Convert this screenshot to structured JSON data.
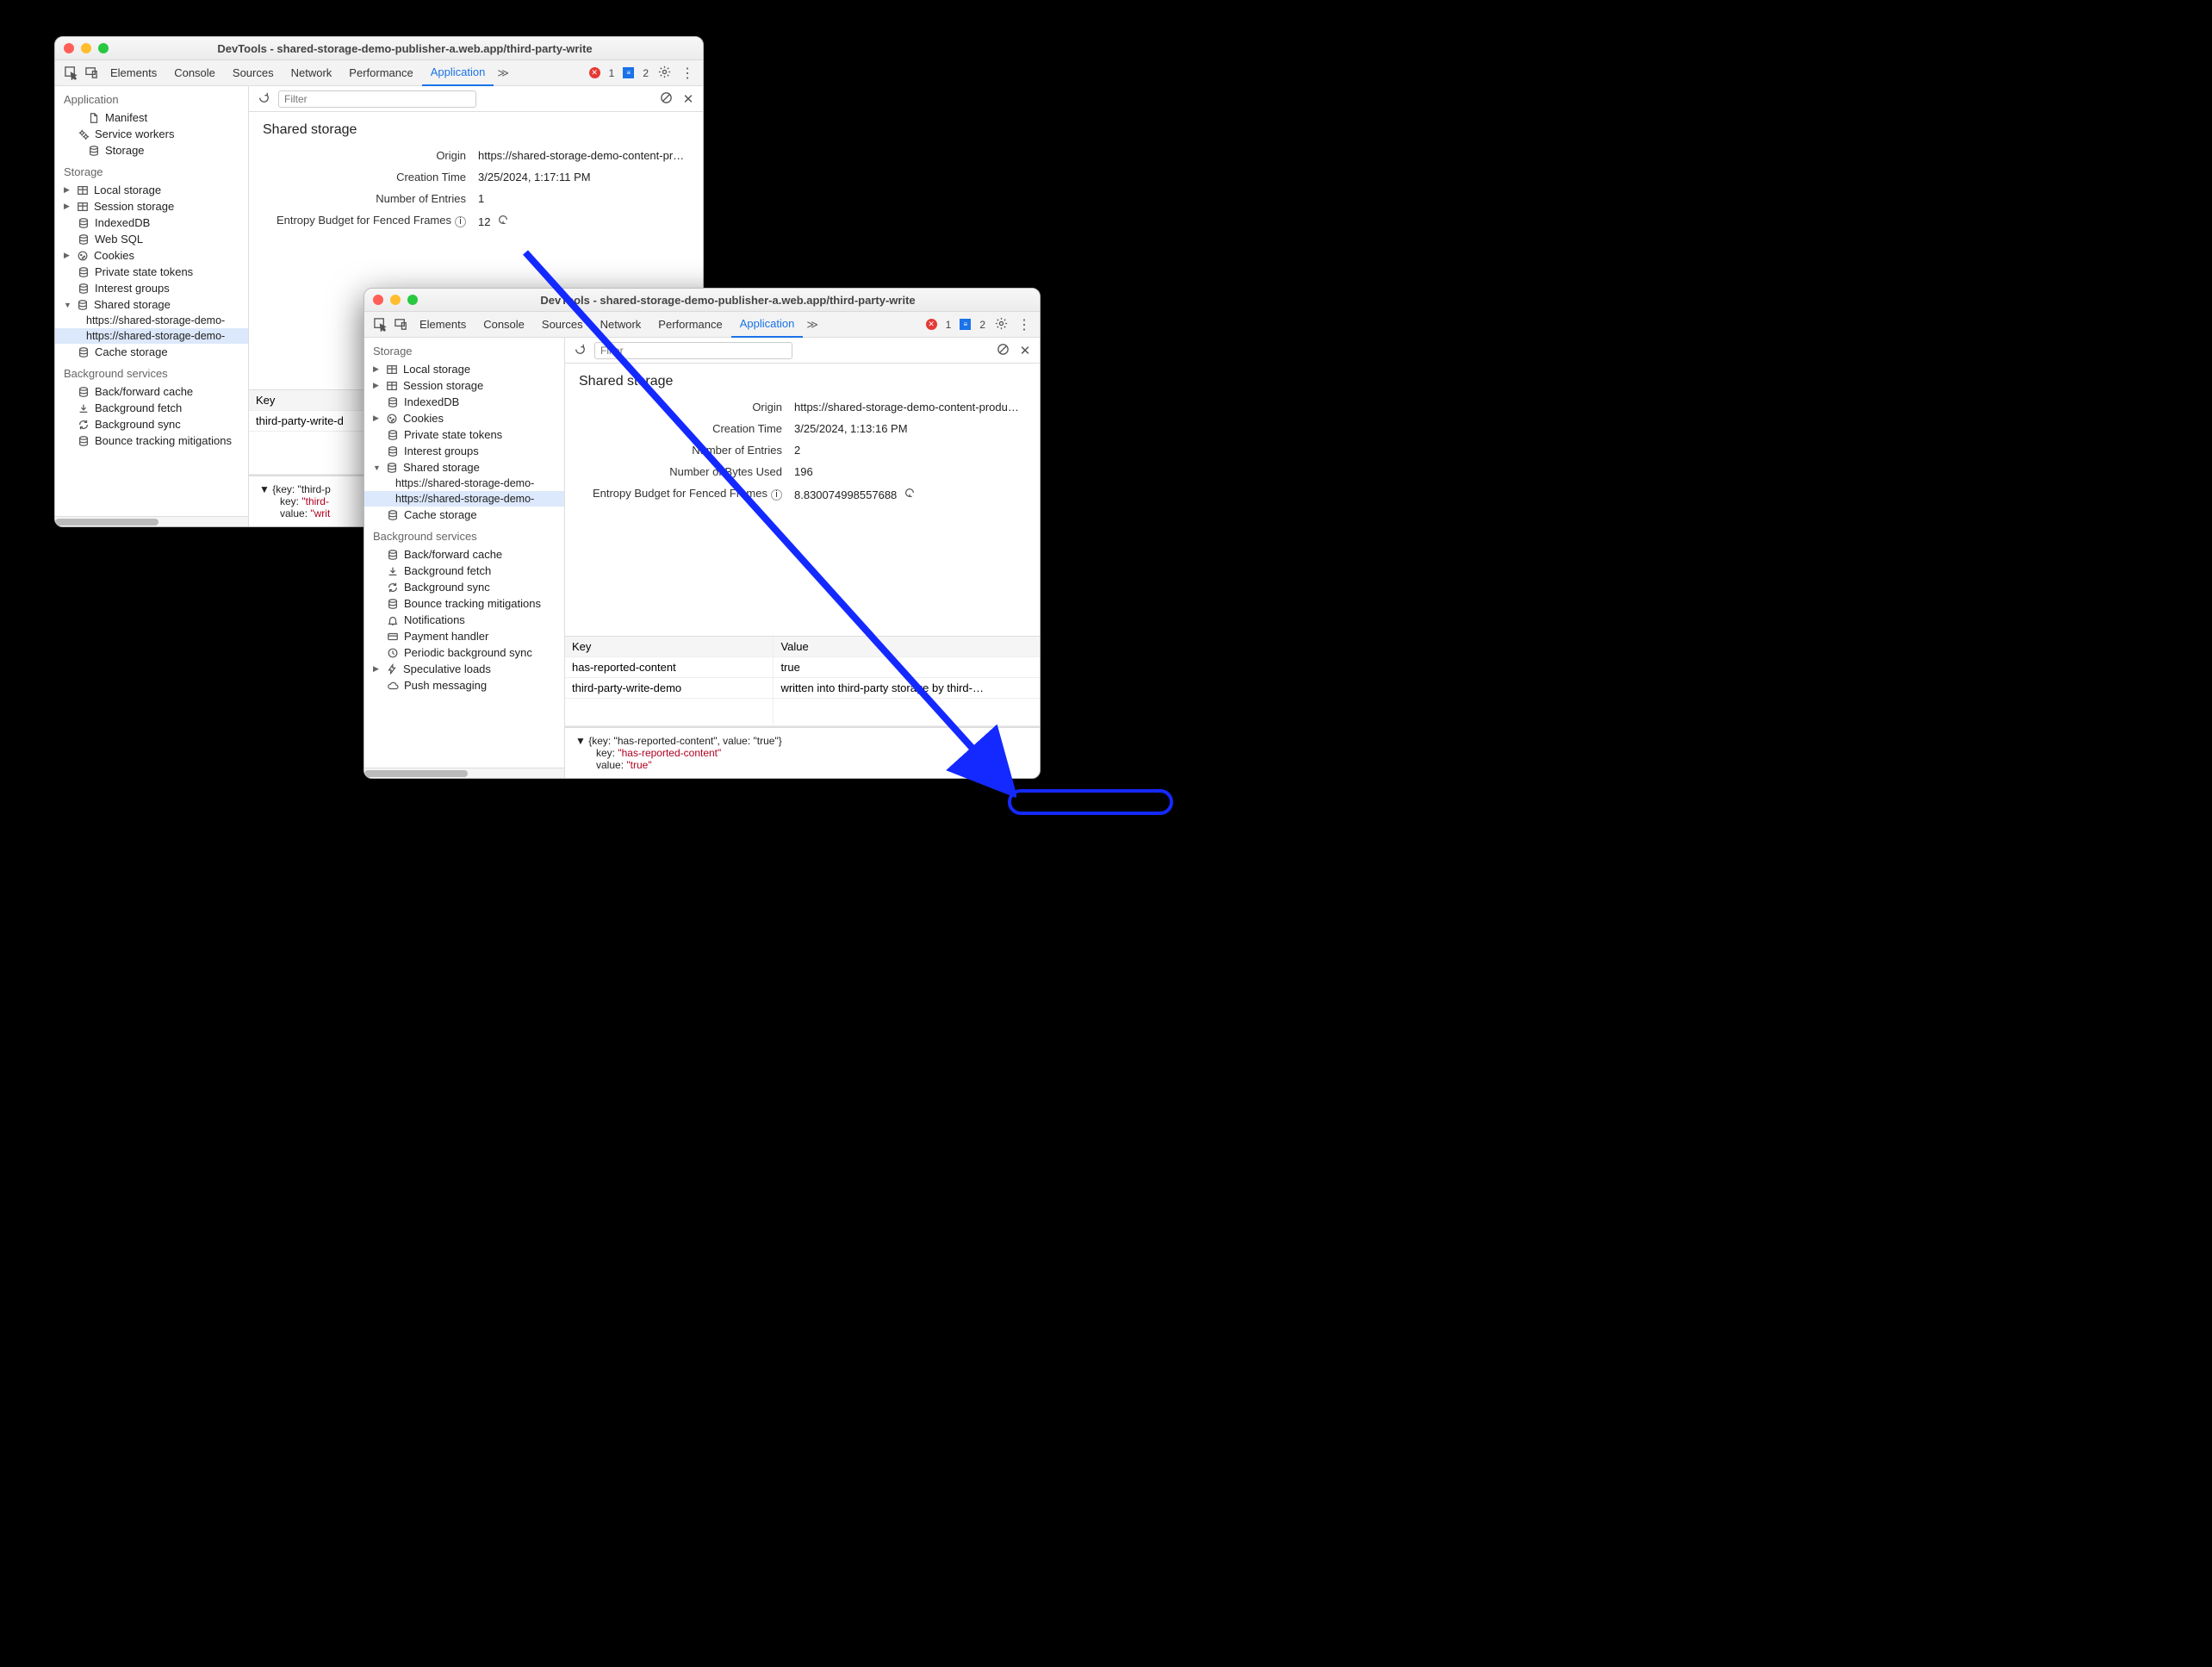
{
  "winA": {
    "title": "DevTools - shared-storage-demo-publisher-a.web.app/third-party-write",
    "tabs": [
      "Elements",
      "Console",
      "Sources",
      "Network",
      "Performance",
      "Application"
    ],
    "activeTab": "Application",
    "errors": "1",
    "messages": "2",
    "filterPlaceholder": "Filter",
    "sidebar": {
      "application": {
        "title": "Application",
        "items": {
          "manifest": "Manifest",
          "service_workers": "Service workers",
          "storage": "Storage"
        }
      },
      "storage": {
        "title": "Storage",
        "items": {
          "local": "Local storage",
          "session": "Session storage",
          "indexed": "IndexedDB",
          "websql": "Web SQL",
          "cookies": "Cookies",
          "private": "Private state tokens",
          "interest": "Interest groups",
          "shared": "Shared storage",
          "shared_origins": [
            "https://shared-storage-demo-",
            "https://shared-storage-demo-"
          ],
          "cache": "Cache storage"
        }
      },
      "bg": {
        "title": "Background services",
        "items": {
          "bfc": "Back/forward cache",
          "bgfetch": "Background fetch",
          "bgsync": "Background sync",
          "bounce": "Bounce tracking mitigations"
        }
      }
    },
    "panel": {
      "title": "Shared storage",
      "origin_k": "Origin",
      "origin_v": "https://shared-storage-demo-content-pr…",
      "ctime_k": "Creation Time",
      "ctime_v": "3/25/2024, 1:17:11 PM",
      "entries_k": "Number of Entries",
      "entries_v": "1",
      "entropy_k": "Entropy Budget for Fenced Frames",
      "entropy_v": "12"
    },
    "table": {
      "key_h": "Key",
      "key_v": "third-party-write-d"
    },
    "object": {
      "line1": "▼ {key: \"third-p",
      "line2_k": "key:",
      "line2_v": "\"third-",
      "line3_k": "value:",
      "line3_v": "\"writ"
    }
  },
  "winB": {
    "title": "DevTools - shared-storage-demo-publisher-a.web.app/third-party-write",
    "tabs": [
      "Elements",
      "Console",
      "Sources",
      "Network",
      "Performance",
      "Application"
    ],
    "activeTab": "Application",
    "errors": "1",
    "messages": "2",
    "filterPlaceholder": "Filter",
    "sidebar": {
      "storage": {
        "title": "Storage",
        "items": {
          "local": "Local storage",
          "session": "Session storage",
          "indexed": "IndexedDB",
          "cookies": "Cookies",
          "private": "Private state tokens",
          "interest": "Interest groups",
          "shared": "Shared storage",
          "shared_origins": [
            "https://shared-storage-demo-",
            "https://shared-storage-demo-"
          ],
          "cache": "Cache storage"
        }
      },
      "bg": {
        "title": "Background services",
        "items": {
          "bfc": "Back/forward cache",
          "bgfetch": "Background fetch",
          "bgsync": "Background sync",
          "bounce": "Bounce tracking mitigations",
          "notif": "Notifications",
          "pay": "Payment handler",
          "periodic": "Periodic background sync",
          "spec": "Speculative loads",
          "push": "Push messaging"
        }
      }
    },
    "panel": {
      "title": "Shared storage",
      "origin_k": "Origin",
      "origin_v": "https://shared-storage-demo-content-produ…",
      "ctime_k": "Creation Time",
      "ctime_v": "3/25/2024, 1:13:16 PM",
      "entries_k": "Number of Entries",
      "entries_v": "2",
      "bytes_k": "Number of Bytes Used",
      "bytes_v": "196",
      "entropy_k": "Entropy Budget for Fenced Frames",
      "entropy_v": "8.830074998557688"
    },
    "table": {
      "key_h": "Key",
      "val_h": "Value",
      "rows": [
        {
          "k": "has-reported-content",
          "v": "true"
        },
        {
          "k": "third-party-write-demo",
          "v": "written into third-party storage by third-…"
        }
      ]
    },
    "object": {
      "line1": "▼ {key: \"has-reported-content\", value: \"true\"}",
      "line2_k": "key:",
      "line2_v": "\"has-reported-content\"",
      "line3_k": "value:",
      "line3_v": "\"true\""
    }
  }
}
